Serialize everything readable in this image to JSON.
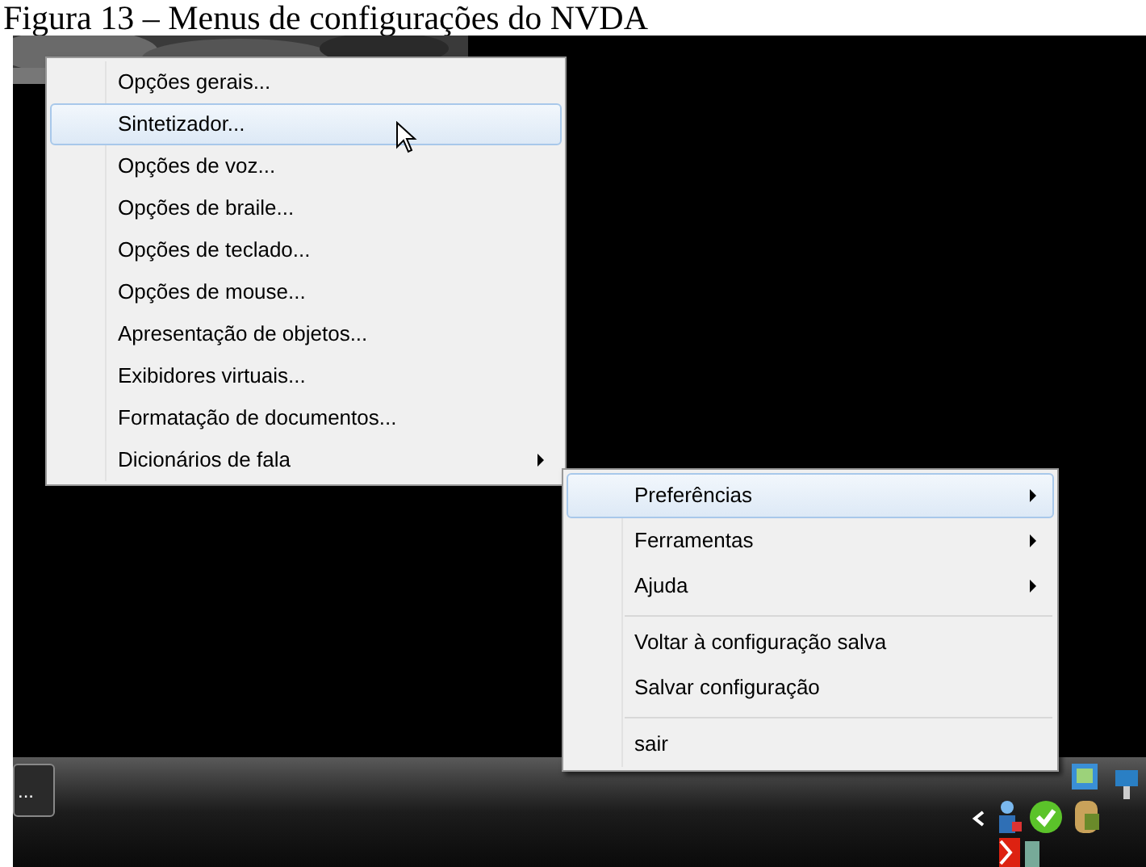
{
  "caption": "Figura 13 – Menus de configurações do NVDA",
  "menu": {
    "items": [
      {
        "label": "Opções gerais...",
        "selected": false,
        "has_submenu": false
      },
      {
        "label": "Sintetizador...",
        "selected": true,
        "has_submenu": false
      },
      {
        "label": "Opções de voz...",
        "selected": false,
        "has_submenu": false
      },
      {
        "label": "Opções de braile...",
        "selected": false,
        "has_submenu": false
      },
      {
        "label": "Opções de teclado...",
        "selected": false,
        "has_submenu": false
      },
      {
        "label": "Opções de mouse...",
        "selected": false,
        "has_submenu": false
      },
      {
        "label": "Apresentação de objetos...",
        "selected": false,
        "has_submenu": false
      },
      {
        "label": "Exibidores virtuais...",
        "selected": false,
        "has_submenu": false
      },
      {
        "label": "Formatação de documentos...",
        "selected": false,
        "has_submenu": false
      },
      {
        "label": "Dicionários de fala",
        "selected": false,
        "has_submenu": true
      }
    ]
  },
  "tray_menu": {
    "items": [
      {
        "label": "Preferências",
        "selected": true,
        "has_submenu": true,
        "separator_before": false
      },
      {
        "label": "Ferramentas",
        "selected": false,
        "has_submenu": true,
        "separator_before": false
      },
      {
        "label": "Ajuda",
        "selected": false,
        "has_submenu": true,
        "separator_before": false
      },
      {
        "label": "Voltar à configuração salva",
        "selected": false,
        "has_submenu": false,
        "separator_before": true
      },
      {
        "label": "Salvar configuração",
        "selected": false,
        "has_submenu": false,
        "separator_before": false
      },
      {
        "label": "sair",
        "selected": false,
        "has_submenu": false,
        "separator_before": true
      }
    ]
  },
  "taskbar": {
    "button": "..."
  }
}
